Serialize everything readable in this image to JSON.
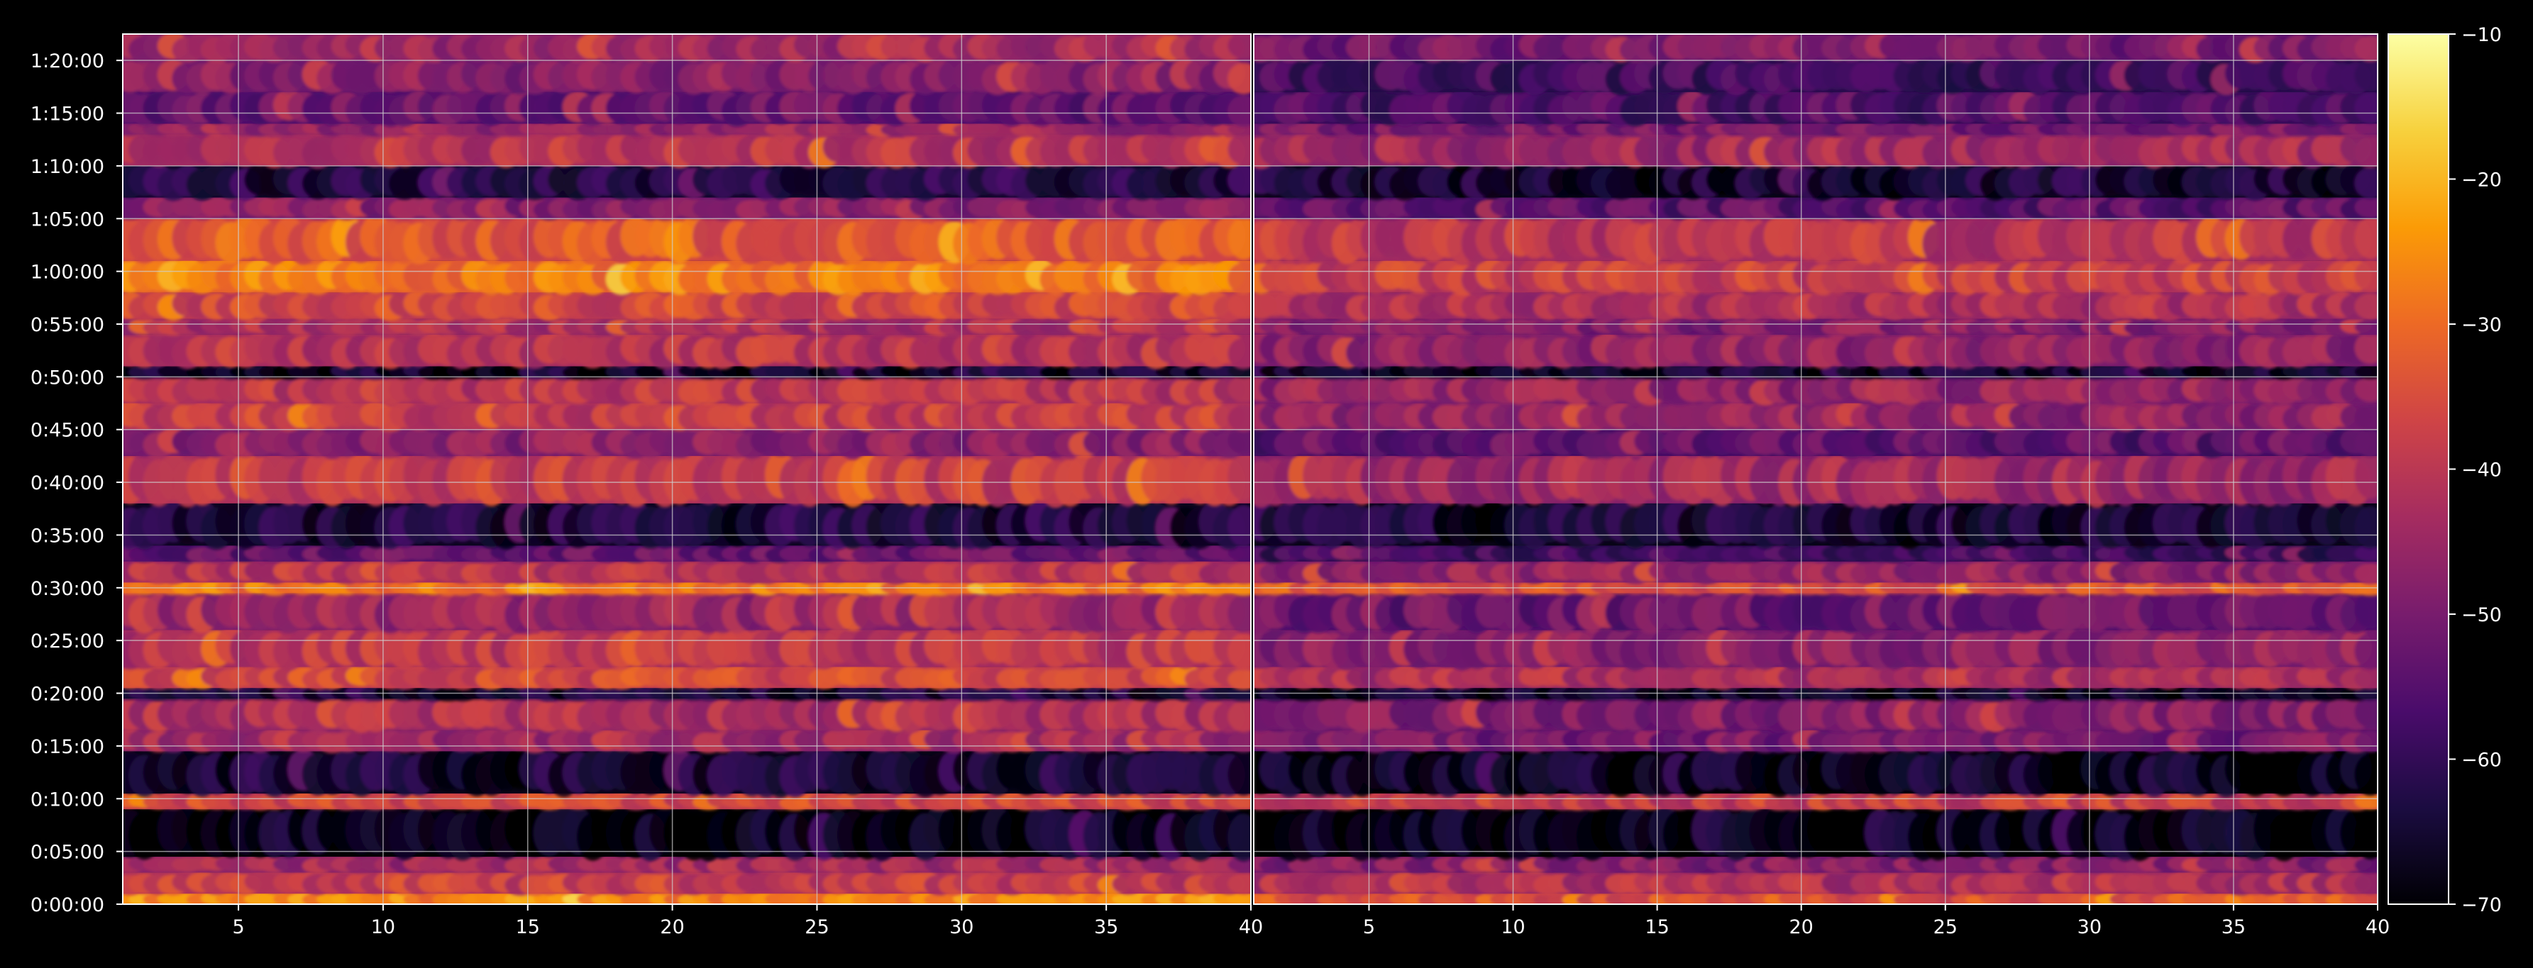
{
  "chart_data": {
    "type": "heatmap",
    "title": "",
    "xlabel": "",
    "ylabel": "",
    "grid": true,
    "colormap": "inferno",
    "colormap_stops": [
      "#000004",
      "#1b0c41",
      "#4a0c6b",
      "#781c6d",
      "#a52c60",
      "#cf4446",
      "#ed6925",
      "#fb9b06",
      "#f7d13d",
      "#fcffa4"
    ],
    "grid_color": "#cfcfcf",
    "text_color": "#ffffff",
    "background_color": "#000000",
    "y_axis": {
      "range_minutes": [
        0,
        82.5
      ],
      "ticks": [
        {
          "minutes": 0,
          "label": "0:00:00"
        },
        {
          "minutes": 5,
          "label": "0:05:00"
        },
        {
          "minutes": 10,
          "label": "0:10:00"
        },
        {
          "minutes": 15,
          "label": "0:15:00"
        },
        {
          "minutes": 20,
          "label": "0:20:00"
        },
        {
          "minutes": 25,
          "label": "0:25:00"
        },
        {
          "minutes": 30,
          "label": "0:30:00"
        },
        {
          "minutes": 35,
          "label": "0:35:00"
        },
        {
          "minutes": 40,
          "label": "0:40:00"
        },
        {
          "minutes": 45,
          "label": "0:45:00"
        },
        {
          "minutes": 50,
          "label": "0:50:00"
        },
        {
          "minutes": 55,
          "label": "0:55:00"
        },
        {
          "minutes": 60,
          "label": "1:00:00"
        },
        {
          "minutes": 65,
          "label": "1:05:00"
        },
        {
          "minutes": 70,
          "label": "1:10:00"
        },
        {
          "minutes": 75,
          "label": "1:15:00"
        },
        {
          "minutes": 80,
          "label": "1:20:00"
        }
      ]
    },
    "panels": [
      {
        "xlim": [
          1,
          40
        ],
        "xticks": [
          5,
          10,
          15,
          20,
          25,
          30,
          35,
          40
        ],
        "band_levels": [
          {
            "from": 0,
            "to": 1,
            "db": -26
          },
          {
            "from": 1,
            "to": 3,
            "db": -38
          },
          {
            "from": 3,
            "to": 4.5,
            "db": -44
          },
          {
            "from": 4.5,
            "to": 9,
            "db": -67
          },
          {
            "from": 9,
            "to": 10.5,
            "db": -36
          },
          {
            "from": 10.5,
            "to": 14.5,
            "db": -64
          },
          {
            "from": 14.5,
            "to": 16.5,
            "db": -44
          },
          {
            "from": 16.5,
            "to": 19.5,
            "db": -42
          },
          {
            "from": 19.5,
            "to": 20.5,
            "db": -64
          },
          {
            "from": 20.5,
            "to": 22.5,
            "db": -36
          },
          {
            "from": 22.5,
            "to": 26,
            "db": -40
          },
          {
            "from": 26,
            "to": 29.5,
            "db": -45
          },
          {
            "from": 29.5,
            "to": 30.5,
            "db": -28
          },
          {
            "from": 30.5,
            "to": 32.5,
            "db": -40
          },
          {
            "from": 32.5,
            "to": 34,
            "db": -53
          },
          {
            "from": 34,
            "to": 38,
            "db": -63
          },
          {
            "from": 38,
            "to": 42.5,
            "db": -38
          },
          {
            "from": 42.5,
            "to": 45,
            "db": -47
          },
          {
            "from": 45,
            "to": 47.5,
            "db": -38
          },
          {
            "from": 47.5,
            "to": 50,
            "db": -40
          },
          {
            "from": 50,
            "to": 51,
            "db": -66
          },
          {
            "from": 51,
            "to": 54,
            "db": -40
          },
          {
            "from": 54,
            "to": 55.5,
            "db": -42
          },
          {
            "from": 55.5,
            "to": 58,
            "db": -36
          },
          {
            "from": 58,
            "to": 61,
            "db": -28
          },
          {
            "from": 61,
            "to": 65,
            "db": -33
          },
          {
            "from": 65,
            "to": 67,
            "db": -48
          },
          {
            "from": 67,
            "to": 70,
            "db": -62
          },
          {
            "from": 70,
            "to": 73,
            "db": -40
          },
          {
            "from": 73,
            "to": 74,
            "db": -45
          },
          {
            "from": 74,
            "to": 77,
            "db": -52
          },
          {
            "from": 77,
            "to": 80,
            "db": -48
          },
          {
            "from": 80,
            "to": 82.5,
            "db": -44
          }
        ]
      },
      {
        "xlim": [
          1,
          40
        ],
        "xticks": [
          5,
          10,
          15,
          20,
          25,
          30,
          35,
          40
        ],
        "band_levels": [
          {
            "from": 0,
            "to": 1,
            "db": -34
          },
          {
            "from": 1,
            "to": 3,
            "db": -42
          },
          {
            "from": 3,
            "to": 4.5,
            "db": -48
          },
          {
            "from": 4.5,
            "to": 9,
            "db": -68
          },
          {
            "from": 9,
            "to": 10.5,
            "db": -38
          },
          {
            "from": 10.5,
            "to": 14.5,
            "db": -66
          },
          {
            "from": 14.5,
            "to": 16.5,
            "db": -50
          },
          {
            "from": 16.5,
            "to": 19.5,
            "db": -48
          },
          {
            "from": 19.5,
            "to": 20.5,
            "db": -66
          },
          {
            "from": 20.5,
            "to": 22.5,
            "db": -42
          },
          {
            "from": 22.5,
            "to": 26,
            "db": -47
          },
          {
            "from": 26,
            "to": 29.5,
            "db": -52
          },
          {
            "from": 29.5,
            "to": 30.5,
            "db": -34
          },
          {
            "from": 30.5,
            "to": 32.5,
            "db": -46
          },
          {
            "from": 32.5,
            "to": 34,
            "db": -58
          },
          {
            "from": 34,
            "to": 38,
            "db": -64
          },
          {
            "from": 38,
            "to": 42.5,
            "db": -44
          },
          {
            "from": 42.5,
            "to": 45,
            "db": -54
          },
          {
            "from": 45,
            "to": 47.5,
            "db": -46
          },
          {
            "from": 47.5,
            "to": 50,
            "db": -46
          },
          {
            "from": 50,
            "to": 51,
            "db": -66
          },
          {
            "from": 51,
            "to": 54,
            "db": -46
          },
          {
            "from": 54,
            "to": 55.5,
            "db": -48
          },
          {
            "from": 55.5,
            "to": 58,
            "db": -42
          },
          {
            "from": 58,
            "to": 61,
            "db": -38
          },
          {
            "from": 61,
            "to": 65,
            "db": -40
          },
          {
            "from": 65,
            "to": 67,
            "db": -54
          },
          {
            "from": 67,
            "to": 70,
            "db": -64
          },
          {
            "from": 70,
            "to": 73,
            "db": -44
          },
          {
            "from": 73,
            "to": 74,
            "db": -50
          },
          {
            "from": 74,
            "to": 77,
            "db": -56
          },
          {
            "from": 77,
            "to": 80,
            "db": -58
          },
          {
            "from": 80,
            "to": 82.5,
            "db": -50
          }
        ]
      }
    ],
    "colorbar": {
      "range": [
        -70,
        -10
      ],
      "ticks": [
        {
          "value": -10,
          "label": "−10"
        },
        {
          "value": -20,
          "label": "−20"
        },
        {
          "value": -30,
          "label": "−30"
        },
        {
          "value": -40,
          "label": "−40"
        },
        {
          "value": -50,
          "label": "−50"
        },
        {
          "value": -60,
          "label": "−60"
        },
        {
          "value": -70,
          "label": "−70"
        }
      ]
    }
  }
}
